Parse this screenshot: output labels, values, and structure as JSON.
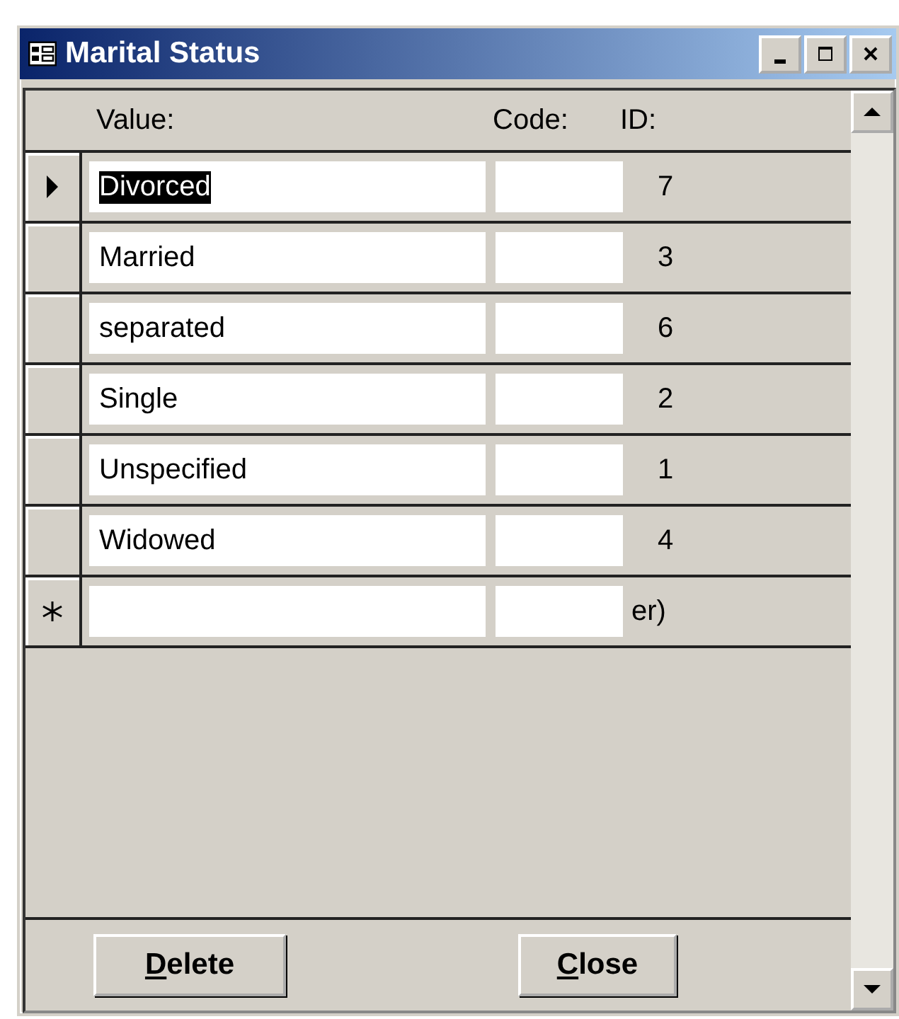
{
  "window": {
    "title": "Marital Status"
  },
  "columns": [
    "Value:",
    "Code:",
    "ID:"
  ],
  "rows": [
    {
      "current": true,
      "new": false,
      "value": "Divorced",
      "value_selected": true,
      "id": "7"
    },
    {
      "current": false,
      "new": false,
      "value": "Married",
      "value_selected": false,
      "id": "3"
    },
    {
      "current": false,
      "new": false,
      "value": "separated",
      "value_selected": false,
      "id": "6"
    },
    {
      "current": false,
      "new": false,
      "value": "Single",
      "value_selected": false,
      "id": "2"
    },
    {
      "current": false,
      "new": false,
      "value": "Unspecified",
      "value_selected": false,
      "id": "1"
    },
    {
      "current": false,
      "new": false,
      "value": "Widowed",
      "value_selected": false,
      "id": "4"
    },
    {
      "current": false,
      "new": true,
      "id": "er)"
    }
  ],
  "buttons": [
    {
      "accel": "D",
      "rest": "elete"
    },
    {
      "accel": "C",
      "rest": "lose"
    }
  ]
}
